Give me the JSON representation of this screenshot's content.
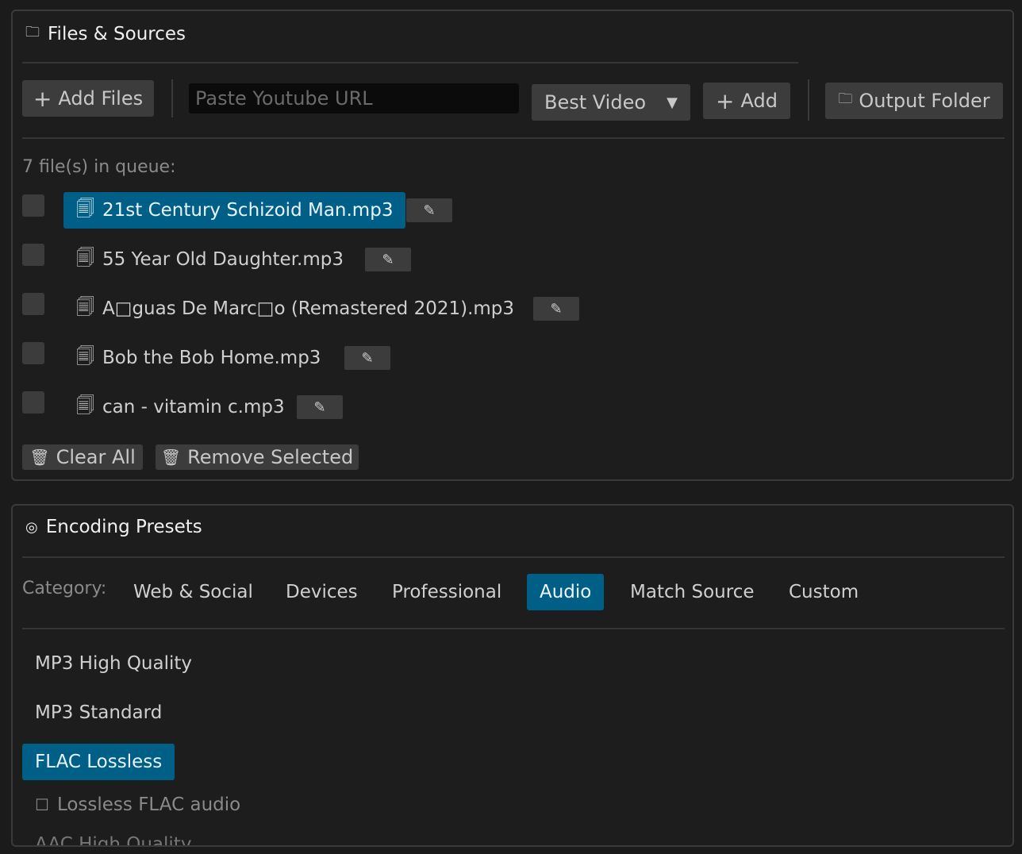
{
  "files_panel": {
    "title": "Files & Sources",
    "title_icon": "folder-icon",
    "add_files_label": "Add Files",
    "url_placeholder": "Paste Youtube URL",
    "quality_selected": "Best Video",
    "add_label": "Add",
    "output_folder_label": "Output Folder",
    "queue_count": "7 file(s) in queue:",
    "files": [
      {
        "name": "21st Century Schizoid Man.mp3",
        "selected": true
      },
      {
        "name": "55 Year Old Daughter.mp3",
        "selected": false
      },
      {
        "name": "A□guas De Marc□o (Remastered 2021).mp3",
        "selected": false
      },
      {
        "name": "Bob the Bob Home.mp3",
        "selected": false
      },
      {
        "name": "can - vitamin c.mp3",
        "selected": false
      }
    ],
    "clear_all_label": "Clear All",
    "remove_selected_label": "Remove Selected"
  },
  "presets_panel": {
    "title": "Encoding Presets",
    "category_label": "Category:",
    "tabs": [
      "Web & Social",
      "Devices",
      "Professional",
      "Audio",
      "Match Source",
      "Custom"
    ],
    "active_tab": "Audio",
    "presets": [
      "MP3 High Quality",
      "MP3 Standard",
      "FLAC Lossless",
      "AAC High Quality"
    ],
    "active_preset": "FLAC Lossless",
    "preset_description": "Lossless FLAC audio"
  },
  "colors": {
    "accent": "#005f87",
    "background": "#1b1b1b"
  }
}
